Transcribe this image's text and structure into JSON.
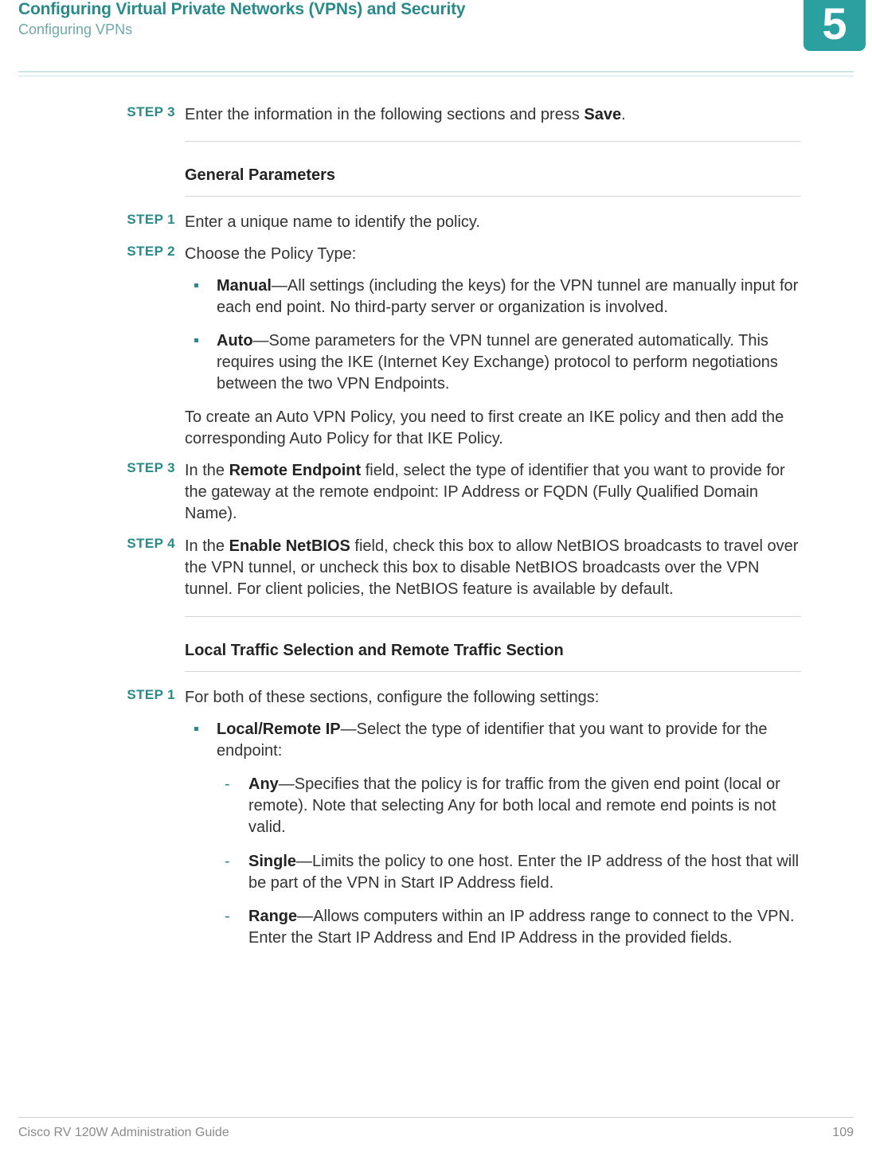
{
  "header": {
    "title": "Configuring Virtual Private Networks (VPNs) and Security",
    "subtitle": "Configuring VPNs",
    "chapter_number": "5"
  },
  "footer": {
    "guide": "Cisco RV 120W Administration Guide",
    "page": "109"
  },
  "steps_top": {
    "s3_label": "STEP  3",
    "s3_text_a": "Enter the information in the following sections and press ",
    "s3_text_b": "Save",
    "s3_text_c": "."
  },
  "section_gp": {
    "title": "General Parameters"
  },
  "gp": {
    "s1_label": "STEP  1",
    "s1_text": "Enter a unique name to identify the policy.",
    "s2_label": "STEP  2",
    "s2_text": "Choose the Policy Type:",
    "s2_b1_b": "Manual",
    "s2_b1_t": "—All settings (including the keys) for the VPN tunnel are manually input for each end point. No third-party server or organization is involved.",
    "s2_b2_b": "Auto",
    "s2_b2_t": "—Some parameters for the VPN tunnel are generated automatically. This requires using the IKE (Internet Key Exchange) protocol to perform negotiations between the two VPN Endpoints.",
    "s2_after": "To create an Auto VPN Policy, you need to first create an IKE policy and then add the corresponding Auto Policy for that IKE Policy.",
    "s3_label": "STEP  3",
    "s3_a": "In the ",
    "s3_b": "Remote Endpoint",
    "s3_c": " field, select the type of identifier that you want to provide for the gateway at the remote endpoint: IP Address or FQDN (Fully Qualified Domain Name).",
    "s4_label": "STEP  4",
    "s4_a": "In the ",
    "s4_b": "Enable NetBIOS",
    "s4_c": " field, check this box to allow NetBIOS broadcasts to travel over the VPN tunnel, or uncheck this box to disable NetBIOS broadcasts over the VPN tunnel. For client policies, the NetBIOS feature is available by default."
  },
  "section_lt": {
    "title": "Local Traffic Selection and Remote Traffic Section"
  },
  "lt": {
    "s1_label": "STEP  1",
    "s1_text": "For both of these sections, configure the following settings:",
    "b1_b": "Local/Remote IP",
    "b1_t": "—Select the type of identifier that you want to provide for the endpoint:",
    "d1_b": "Any",
    "d1_t": "—Specifies that the policy is for traffic from the given end point (local or remote). Note that selecting Any for both local and remote end points is not valid.",
    "d2_b": "Single",
    "d2_t": "—Limits the policy to one host. Enter the IP address of the host that will be part of the VPN in Start IP Address field.",
    "d3_b": "Range",
    "d3_t": "—Allows computers within an IP address range to connect to the VPN. Enter the Start IP Address and End IP Address in the provided fields."
  }
}
